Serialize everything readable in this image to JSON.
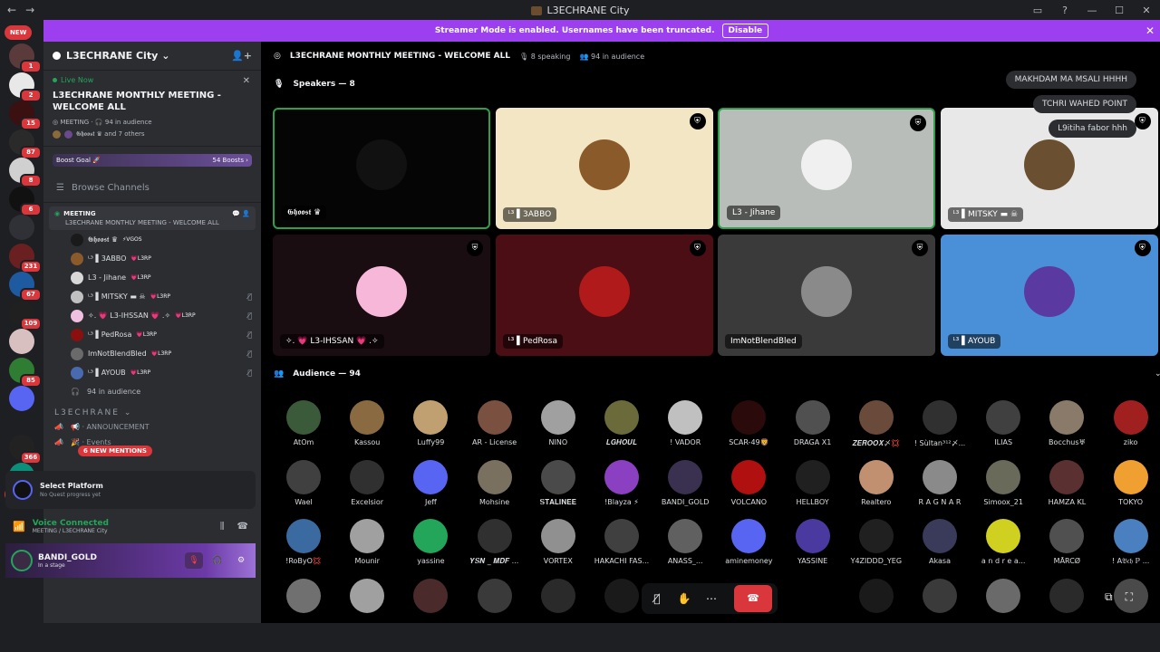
{
  "window": {
    "title": "L3ECHRANE City",
    "back_glyph": "←",
    "forward_glyph": "→",
    "min_glyph": "—",
    "max_glyph": "☐",
    "close_glyph": "✕"
  },
  "banner": {
    "text": "Streamer Mode is enabled. Usernames have been truncated.",
    "button": "Disable",
    "close_glyph": "✕"
  },
  "rail": {
    "new_top": "NEW",
    "new_bottom": "NEW",
    "servers": [
      {
        "badge": "1",
        "color": "#5a3a3a"
      },
      {
        "badge": "2",
        "color": "#e8e8e8"
      },
      {
        "badge": "15",
        "color": "#3a1010"
      },
      {
        "badge": "87",
        "color": "#2a2a2a"
      },
      {
        "badge": "8",
        "color": "#d0d0d0"
      },
      {
        "badge": "6",
        "color": "#111111"
      },
      {
        "badge": "",
        "color": "#2f3136"
      },
      {
        "badge": "231",
        "color": "#6a2020"
      },
      {
        "badge": "67",
        "color": "#1e5aa0"
      },
      {
        "badge": "109",
        "color": "#202020"
      },
      {
        "badge": "",
        "color": "#d8c0c0"
      },
      {
        "badge": "85",
        "color": "#2e7d32"
      },
      {
        "badge": "",
        "color": "#5865f2"
      },
      {
        "badge": "366",
        "color": "#222222"
      },
      {
        "badge": "",
        "color": "#0b8f7a"
      }
    ]
  },
  "sidebar": {
    "guild_name": "L3ECHRANE City",
    "guild_chevron": "⌄",
    "add_member_icon": "👤+",
    "live_label": "Live Now",
    "live_close": "✕",
    "live_title": "L3ECHRANE MONTHLY MEETING - WELCOME ALL",
    "live_meta_channel": "MEETING",
    "live_meta_audience": "94 in audience",
    "live_people": "𝕲𝖍𝖔𝖔𝖘𝖙 ♛ and 7 others",
    "boost_label": "Boost Goal 🚀",
    "boost_value": "54 Boosts ›",
    "browse": "Browse Channels",
    "meeting_name": "MEETING",
    "meeting_topic": "L3ECHRANE MONTHLY MEETING - WELCOME ALL",
    "vc_users": [
      {
        "name": "𝕲𝖍𝖔𝖔𝖘𝖙 ♛",
        "tag": "⚡VGOS",
        "color": "#1a1a1a",
        "muted": false
      },
      {
        "name": "ᴸ³ ▌3ABBO",
        "tag": "💗L3RP",
        "color": "#8a5a2a",
        "muted": false
      },
      {
        "name": "L3 - Jihane",
        "tag": "💗L3RP",
        "color": "#d8d8d8",
        "muted": false
      },
      {
        "name": "ᴸ³ ▌MITSKY ▬ ☠",
        "tag": "💗L3RP",
        "color": "#c0c0c0",
        "muted": true
      },
      {
        "name": "✧. 💗 L3-IHSSAN 💗 .✧",
        "tag": "💗L3RP",
        "color": "#f0c0e0",
        "muted": true
      },
      {
        "name": "ᴸ³ ▌PedRosa",
        "tag": "💗L3RP",
        "color": "#8a1010",
        "muted": true
      },
      {
        "name": "ImNotBlendBled",
        "tag": "💗L3RP",
        "color": "#6a6a6a",
        "muted": true
      },
      {
        "name": "ᴸ³ ▌AYOUB",
        "tag": "💗L3RP",
        "color": "#4a6ab0",
        "muted": true
      }
    ],
    "audience_row": "94 in audience",
    "category": "L3ECHRANE",
    "channels": [
      "📢 · ANNOUNCEMENT",
      "🎉 · Events"
    ],
    "mentions": "6 NEW MENTIONS"
  },
  "platform": {
    "title": "Select Platform",
    "sub": "No Quest progress yet"
  },
  "voice": {
    "status": "Voice Connected",
    "where": "MEETING / L3ECHRANE City"
  },
  "user": {
    "name": "BANDI_GOLD",
    "status": "In a stage"
  },
  "stage": {
    "title": "L3ECHRANE MONTHLY MEETING - WELCOME ALL",
    "speaking": "8 speaking",
    "audience": "94 in audience",
    "speakers_label": "Speakers — 8",
    "audience_label": "Audience — 94",
    "speakers": [
      {
        "name": "𝕲𝖍𝖔𝖔𝖘𝖙 ♛",
        "bg": "#050505",
        "ava": "#111111",
        "speaking": true,
        "shield": false
      },
      {
        "name": "ᴸ³ ▌3ABBO",
        "bg": "#f2e6c4",
        "ava": "#8a5a2a",
        "speaking": false,
        "shield": true
      },
      {
        "name": "L3 - Jihane",
        "bg": "#b9bdb9",
        "ava": "#f0f0f0",
        "speaking": true,
        "shield": true
      },
      {
        "name": "ᴸ³ ▌MITSKY ▬ ☠",
        "bg": "#e8e8e8",
        "ava": "#6a5030",
        "speaking": false,
        "shield": true
      },
      {
        "name": "✧. 💗 L3-IHSSAN 💗 .✧",
        "bg": "#1a0d12",
        "ava": "#f7b7d8",
        "speaking": false,
        "shield": true
      },
      {
        "name": "ᴸ³ ▌PedRosa",
        "bg": "#4a0e14",
        "ava": "#b01a1a",
        "speaking": false,
        "shield": true
      },
      {
        "name": "ImNotBlendBled",
        "bg": "#3a3a3a",
        "ava": "#8a8a8a",
        "speaking": false,
        "shield": true
      },
      {
        "name": "ᴸ³ ▌AYOUB",
        "bg": "#4a90d8",
        "ava": "#5a3aa0",
        "speaking": false,
        "shield": true
      }
    ],
    "chat": [
      "MAKHDAM MA MSALI HHHH",
      "TCHRI WAHED POINT",
      "L9itiha fabor hhh"
    ],
    "audience_members": [
      {
        "name": "AtOm",
        "color": "#3a5a3a"
      },
      {
        "name": "Kassou",
        "color": "#8a6a40"
      },
      {
        "name": "Luffy99",
        "color": "#c0a070"
      },
      {
        "name": "AR - License",
        "color": "#7a5040"
      },
      {
        "name": "NINO",
        "color": "#a0a0a0"
      },
      {
        "name": "𝑳𝑮𝑯𝑶𝑼𝑳",
        "color": "#6a6a3a"
      },
      {
        "name": "! VADOR",
        "color": "#c0c0c0"
      },
      {
        "name": "SCAR-49🦁",
        "color": "#2a0a0a"
      },
      {
        "name": "DRAGA X1",
        "color": "#505050"
      },
      {
        "name": "𝒁𝑬𝑹𝑶𝑶𝑿〆💢",
        "color": "#6a4a3a"
      },
      {
        "name": "! Sùltan³¹²〆...",
        "color": "#303030"
      },
      {
        "name": "ILIAS",
        "color": "#404040"
      },
      {
        "name": "Bocchus♅",
        "color": "#8a7a6a"
      },
      {
        "name": "ziko",
        "color": "#a02020"
      },
      {
        "name": "Wael",
        "color": "#404040"
      },
      {
        "name": "Excelsior",
        "color": "#303030"
      },
      {
        "name": "Jeff",
        "color": "#5865f2"
      },
      {
        "name": "Mohsine",
        "color": "#7a7060"
      },
      {
        "name": "𝐒𝐓𝐀𝐋𝐈𝐍𝐄𝐄",
        "color": "#4a4a4a"
      },
      {
        "name": "!Blayza ⚡",
        "color": "#8a40c0"
      },
      {
        "name": "BANDI_GOLD",
        "color": "#3a3050"
      },
      {
        "name": "VOLCANO",
        "color": "#b01010"
      },
      {
        "name": "HELLBOY",
        "color": "#202020"
      },
      {
        "name": "Realtero",
        "color": "#c09070"
      },
      {
        "name": "R A G N A R",
        "color": "#8a8a8a"
      },
      {
        "name": "Simoox_21",
        "color": "#6a6a5a"
      },
      {
        "name": "HAMZA KL",
        "color": "#5a3030"
      },
      {
        "name": "TOKYO",
        "color": "#f0a030"
      },
      {
        "name": "!RoByO💢",
        "color": "#3a6aa0"
      },
      {
        "name": "Mounir",
        "color": "#a0a0a0"
      },
      {
        "name": "yassine",
        "color": "#23a55a"
      },
      {
        "name": "𝒀𝑺𝑵 _ 𝑴𝑫𝑭 ...",
        "color": "#303030"
      },
      {
        "name": "VORTEX",
        "color": "#909090"
      },
      {
        "name": "HAKACHI FAS...",
        "color": "#404040"
      },
      {
        "name": "ANASS_...",
        "color": "#606060"
      },
      {
        "name": "aminemoney",
        "color": "#5865f2"
      },
      {
        "name": "YASSINE",
        "color": "#4a3aa0"
      },
      {
        "name": "Y4ZIDDD_YEG",
        "color": "#202020"
      },
      {
        "name": "Akasa",
        "color": "#3a3a5a"
      },
      {
        "name": "a n d r e a...",
        "color": "#d0d020"
      },
      {
        "name": "MĀRCØ",
        "color": "#505050"
      },
      {
        "name": "! A𝔅𝔠𝔥 ℙ ...",
        "color": "#4a80c0"
      }
    ],
    "partial_row": [
      "#707070",
      "#a0a0a0",
      "#4a2a2a",
      "#3a3a3a",
      "#2a2a2a",
      "#1a1a1a",
      "",
      "",
      "",
      "#1a1a1a",
      "#3a3a3a",
      "#6a6a6a",
      "#2a2a2a",
      "#4a4a4a"
    ]
  },
  "controls": {
    "mute_icon": "🎙̸",
    "hand_icon": "✋",
    "more_icon": "⋯",
    "leave_icon": "☎",
    "popout_icon": "⧉",
    "fullscreen_icon": "⛶"
  },
  "colors": {
    "banner": "#9b3fef",
    "speaking": "#2ea04c",
    "danger": "#da373c",
    "blurple": "#5865f2"
  }
}
